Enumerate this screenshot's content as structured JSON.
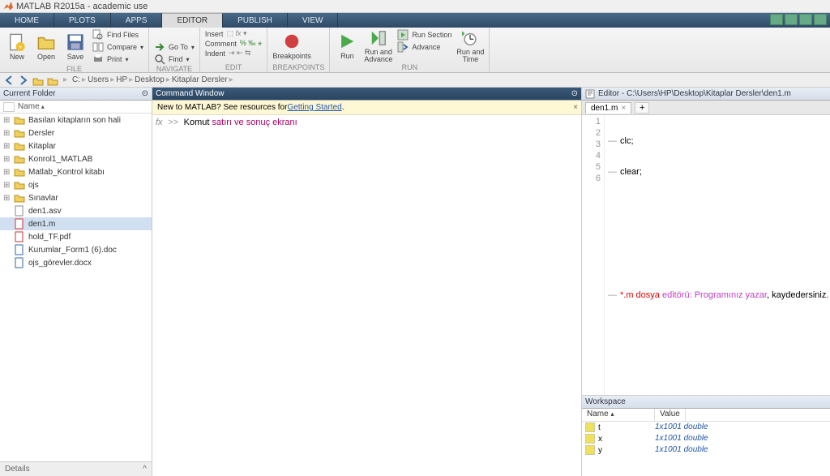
{
  "window": {
    "title": "MATLAB R2015a - academic use"
  },
  "tabs": {
    "home": "HOME",
    "plots": "PLOTS",
    "apps": "APPS",
    "editor": "EDITOR",
    "publish": "PUBLISH",
    "view": "VIEW"
  },
  "ribbon": {
    "file": {
      "new": "New",
      "open": "Open",
      "save": "Save",
      "findFiles": "Find Files",
      "compare": "Compare",
      "print": "Print",
      "label": "FILE"
    },
    "navigate": {
      "goTo": "Go To",
      "find": "Find",
      "label": "NAVIGATE"
    },
    "edit": {
      "insert": "Insert",
      "comment": "Comment",
      "indent": "Indent",
      "label": "EDIT"
    },
    "breakpoints": {
      "breakpoints": "Breakpoints",
      "label": "BREAKPOINTS"
    },
    "run": {
      "run": "Run",
      "runAdvance": "Run and\nAdvance",
      "runSection": "Run Section",
      "advance": "Advance",
      "runTime": "Run and\nTime",
      "label": "RUN"
    }
  },
  "path": {
    "segs": [
      "C:",
      "Users",
      "HP",
      "Desktop",
      "Kitaplar Dersler"
    ]
  },
  "currentFolder": {
    "title": "Current Folder",
    "header": "Name",
    "items": [
      {
        "name": "Basılan kitapların son hali",
        "type": "folder",
        "expandable": true
      },
      {
        "name": "Dersler",
        "type": "folder",
        "expandable": true
      },
      {
        "name": "Kitaplar",
        "type": "folder",
        "expandable": true
      },
      {
        "name": "Konrol1_MATLAB",
        "type": "folder",
        "expandable": true
      },
      {
        "name": "Matlab_Kontrol kitabı",
        "type": "folder",
        "expandable": true
      },
      {
        "name": "ojs",
        "type": "folder",
        "expandable": true
      },
      {
        "name": "Sınavlar",
        "type": "folder",
        "expandable": true
      },
      {
        "name": "den1.asv",
        "type": "file"
      },
      {
        "name": "den1.m",
        "type": "mfile",
        "selected": true
      },
      {
        "name": "hold_TF.pdf",
        "type": "pdf"
      },
      {
        "name": "Kurumlar_Form1 (6).doc",
        "type": "doc"
      },
      {
        "name": "ojs_görevler.docx",
        "type": "doc"
      }
    ],
    "details": "Details"
  },
  "commandWindow": {
    "title": "Command Window",
    "bannerPre": "New to MATLAB? See resources for ",
    "bannerLink": "Getting Started",
    "bannerPost": ".",
    "prompt": ">>",
    "fx": "fx",
    "line": {
      "black": "Komut ",
      "pink": "satırı ve sonuç ekranı"
    }
  },
  "editor": {
    "title": "Editor - C:\\Users\\HP\\Desktop\\Kitaplar Dersler\\den1.m",
    "tab": "den1.m",
    "lines": [
      "1",
      "2",
      "3",
      "4",
      "5",
      "6"
    ],
    "code": {
      "l1": "clc;",
      "l2": "clear;",
      "l6a": "*.m dosya ",
      "l6b": "editörü: Programınız yazar",
      "l6c": ", kaydedersiniz",
      "l6d": "."
    }
  },
  "workspace": {
    "title": "Workspace",
    "colName": "Name",
    "colValue": "Value",
    "rows": [
      {
        "name": "t",
        "value": "1x1001 double"
      },
      {
        "name": "x",
        "value": "1x1001 double"
      },
      {
        "name": "y",
        "value": "1x1001 double"
      }
    ]
  }
}
